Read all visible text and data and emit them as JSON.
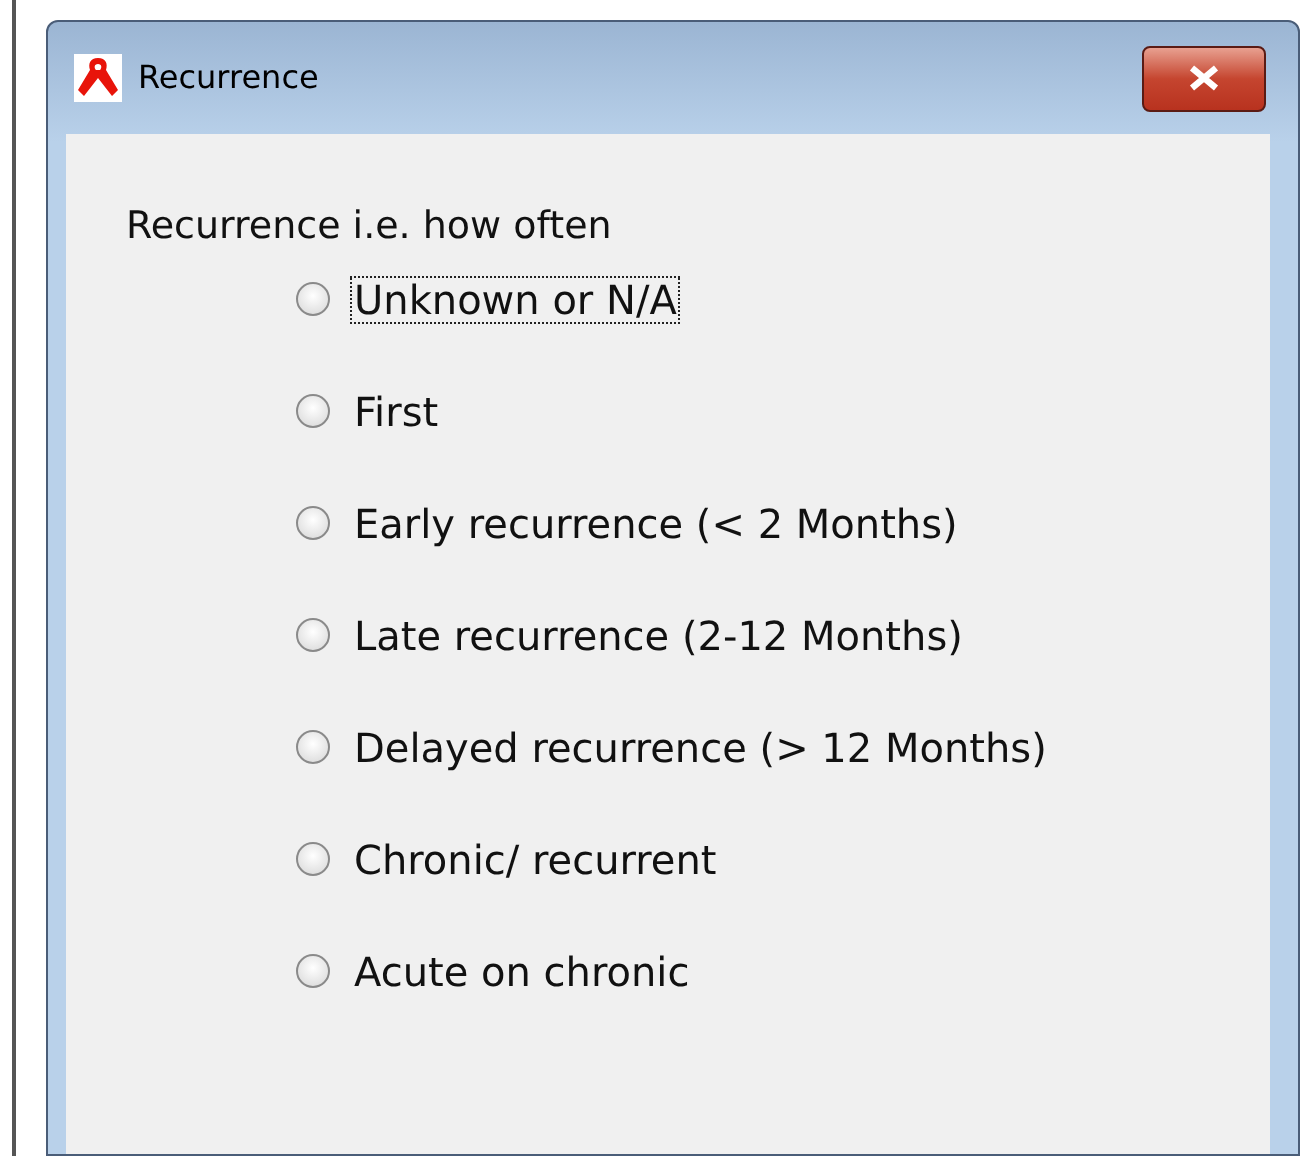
{
  "window": {
    "title": "Recurrence"
  },
  "group": {
    "label": "Recurrence i.e. how often",
    "options": [
      {
        "label": "Unknown or N/A",
        "selected": false,
        "focused": true
      },
      {
        "label": "First",
        "selected": false,
        "focused": false
      },
      {
        "label": "Early recurrence (< 2 Months)",
        "selected": false,
        "focused": false
      },
      {
        "label": "Late recurrence (2-12 Months)",
        "selected": false,
        "focused": false
      },
      {
        "label": "Delayed recurrence (> 12 Months)",
        "selected": false,
        "focused": false
      },
      {
        "label": "Chronic/ recurrent",
        "selected": false,
        "focused": false
      },
      {
        "label": "Acute on chronic",
        "selected": false,
        "focused": false
      }
    ]
  }
}
